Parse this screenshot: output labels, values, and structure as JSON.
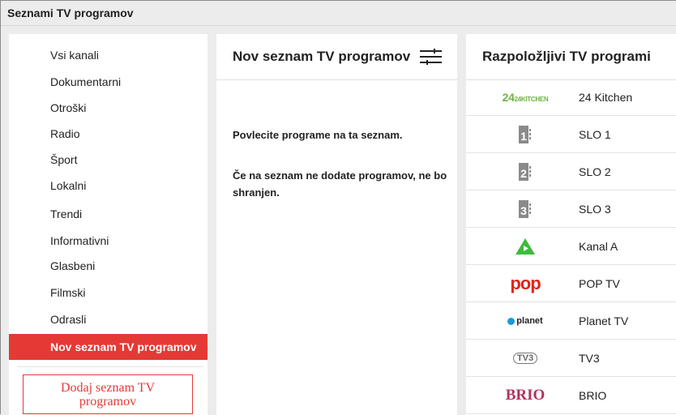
{
  "window": {
    "title": "Seznami TV programov"
  },
  "sidebar": {
    "items": [
      {
        "label": "Vsi kanali"
      },
      {
        "label": "Dokumentarni"
      },
      {
        "label": "Otroški"
      },
      {
        "label": "Radio"
      },
      {
        "label": "Šport"
      },
      {
        "label": "Lokalni"
      },
      {
        "label": "Trendi"
      },
      {
        "label": "Informativni"
      },
      {
        "label": "Glasbeni"
      },
      {
        "label": "Filmski"
      },
      {
        "label": "Odrasli"
      },
      {
        "label": "Nov seznam TV programov",
        "active": true
      }
    ],
    "add_button": "Dodaj seznam TV programov"
  },
  "new_list": {
    "title": "Nov seznam TV programov",
    "hint_drag": "Povlecite programe na ta seznam.",
    "hint_empty": "Če na seznam ne dodate programov, ne bo shranjen."
  },
  "available": {
    "title": "Razpoložljivi TV programi",
    "channels": [
      {
        "name": "24 Kitchen",
        "logo_text": "24KITCHEN",
        "icon": "24kitchen-logo"
      },
      {
        "name": "SLO 1",
        "logo_text": "1",
        "icon": "slo1-logo"
      },
      {
        "name": "SLO 2",
        "logo_text": "2",
        "icon": "slo2-logo"
      },
      {
        "name": "SLO 3",
        "logo_text": "3",
        "icon": "slo3-logo"
      },
      {
        "name": "Kanal A",
        "icon": "kanal-a-logo"
      },
      {
        "name": "POP TV",
        "logo_text": "pop",
        "icon": "pop-tv-logo"
      },
      {
        "name": "Planet TV",
        "logo_text": "planet",
        "icon": "planet-tv-logo"
      },
      {
        "name": "TV3",
        "logo_text": "TV3",
        "icon": "tv3-logo"
      },
      {
        "name": "BRIO",
        "logo_text": "BRIO",
        "icon": "brio-logo"
      }
    ]
  },
  "colors": {
    "accent": "#e53935",
    "background": "#ececec",
    "panel": "#ffffff"
  }
}
